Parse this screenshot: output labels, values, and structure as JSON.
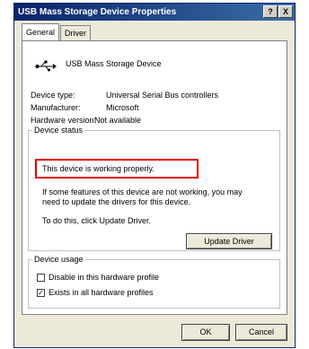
{
  "window": {
    "title": "USB Mass Storage Device Properties",
    "help_btn": "?",
    "close_btn": "X"
  },
  "tabs": [
    {
      "label": "General",
      "active": true
    },
    {
      "label": "Driver",
      "active": false
    }
  ],
  "device": {
    "name": "USB Mass Storage Device",
    "icon": "usb-icon"
  },
  "properties": [
    {
      "label": "Device type:",
      "value": "Universal Serial Bus controllers"
    },
    {
      "label": "Manufacturer:",
      "value": "Microsoft"
    },
    {
      "label": "Hardware version:",
      "value": "Not available"
    }
  ],
  "status": {
    "group_label": "Device status",
    "text": "This device is working properly.",
    "help_line1": "If some features of this device are not working, you may",
    "help_line2": "need to update the drivers for this device.",
    "update_hint": "To do this, click Update Driver.",
    "update_button": "Update Driver"
  },
  "usage": {
    "group_label": "Device usage",
    "options": [
      {
        "label": "Disable in this hardware profile",
        "checked": false
      },
      {
        "label": "Exists in all hardware profiles",
        "checked": true
      }
    ]
  },
  "footer": {
    "ok": "OK",
    "cancel": "Cancel"
  },
  "colors": {
    "highlight_border": "#e00000",
    "titlebar": "#0a246a"
  }
}
